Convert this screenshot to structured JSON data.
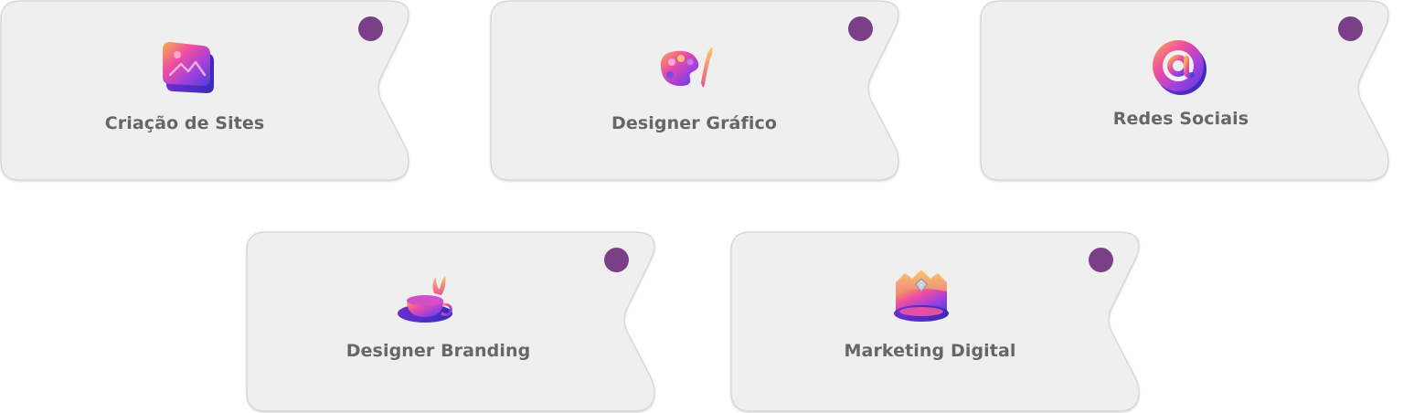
{
  "colors": {
    "card_fill": "#efefef",
    "card_border": "#d4d4d4",
    "dot": "#7b3f88",
    "label": "#666666"
  },
  "services": [
    {
      "label": "Criação de Sites",
      "icon": "image-frame-icon"
    },
    {
      "label": "Designer Gráfico",
      "icon": "paint-palette-icon"
    },
    {
      "label": "Redes Sociais",
      "icon": "at-sign-icon"
    },
    {
      "label": "Designer Branding",
      "icon": "coffee-cup-icon"
    },
    {
      "label": "Marketing Digital",
      "icon": "crown-icon"
    }
  ]
}
